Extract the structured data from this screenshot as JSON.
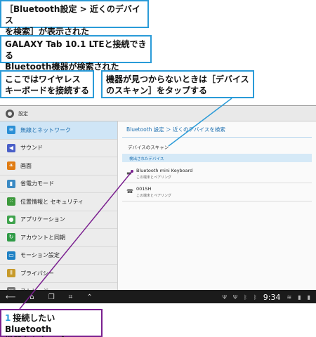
{
  "callouts": {
    "c1": "［Bluetooth設定 > 近くのデバイス\nを検索］が表示された",
    "c2": "GALAXY Tab 10.1 LTEと接続できる\nBluetooth機器が検索された",
    "c3": "ここではワイヤレス\nキーボードを接続する",
    "c4": "機器が見つからないときは［デバイス\nのスキャン］をタップする",
    "c5_step": "1",
    "c5": "接続したいBluetooth\n機器名をタップ"
  },
  "app_bar": {
    "title": "設定"
  },
  "sidebar": {
    "items": [
      {
        "label": "無線とネットワーク",
        "icon": "wifi-icon",
        "color": "#2a8fd6"
      },
      {
        "label": "サウンド",
        "icon": "speaker-icon",
        "color": "#4a5fc8"
      },
      {
        "label": "画面",
        "icon": "display-icon",
        "color": "#e07b12"
      },
      {
        "label": "省電力モード",
        "icon": "battery-icon",
        "color": "#3b8ac4"
      },
      {
        "label": "位置情報と セキュリティ",
        "icon": "location-icon",
        "color": "#3e9a3e"
      },
      {
        "label": "アプリケーション",
        "icon": "apps-icon",
        "color": "#3fa34d"
      },
      {
        "label": "アカウントと同期",
        "icon": "sync-icon",
        "color": "#2f9a46"
      },
      {
        "label": "モーション設定",
        "icon": "motion-icon",
        "color": "#1e80c4"
      },
      {
        "label": "プライバシー",
        "icon": "privacy-icon",
        "color": "#c79a2a"
      },
      {
        "label": "ストレージ",
        "icon": "storage-icon",
        "color": "#777777"
      }
    ]
  },
  "content": {
    "breadcrumb": "Bluetooth 設定 ＞ 近くのデバイスを検索",
    "scan_label": "デバイスのスキャン",
    "found_header": "検出されたデバイス",
    "devices": [
      {
        "name": "Bluetooth mini Keyboard",
        "sub": "この端末とペアリング",
        "icon": "keyboard-icon"
      },
      {
        "name": "001SH",
        "sub": "この端末とペアリング",
        "icon": "phone-icon"
      }
    ]
  },
  "system_bar": {
    "clock": "9:34"
  },
  "colors": {
    "callout_blue": "#2a9bd8",
    "callout_purple": "#7a1f8f"
  }
}
